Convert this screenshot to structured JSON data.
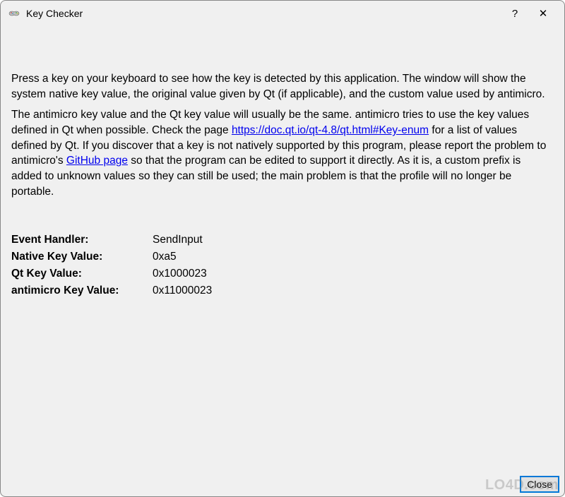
{
  "titlebar": {
    "title": "Key Checker",
    "help_symbol": "?",
    "close_symbol": "✕"
  },
  "description": {
    "para1": "Press a key on your keyboard to see how the key is detected by this application. The window will show the system native key value, the original value given by Qt (if applicable), and the custom value used by antimicro.",
    "para2_part1": "The antimicro key value and the Qt key value will usually be the same. antimicro tries to use the key values defined in Qt when possible. Check the page ",
    "para2_link1": "https://doc.qt.io/qt-4.8/qt.html#Key-enum",
    "para2_part2": " for a list of values defined by Qt. If you discover that a key is not natively supported by this program, please report the problem to antimicro's ",
    "para2_link2": "GitHub page",
    "para2_part3": " so that the program can be edited to support it directly. As it is, a custom prefix is added to unknown values so they can still be used; the main problem is that the profile will no longer be portable."
  },
  "fields": {
    "event_handler_label": "Event Handler:",
    "event_handler_value": "SendInput",
    "native_key_label": "Native Key Value:",
    "native_key_value": "0xa5",
    "qt_key_label": "Qt Key Value:",
    "qt_key_value": "0x1000023",
    "antimicro_key_label": "antimicro Key Value:",
    "antimicro_key_value": "0x11000023"
  },
  "buttons": {
    "close_label": "Close"
  },
  "watermark": "LO4D.com"
}
